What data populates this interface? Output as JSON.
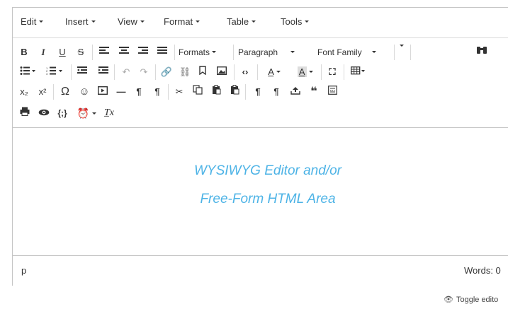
{
  "menubar": {
    "items": [
      {
        "label": "Edit"
      },
      {
        "label": "Insert"
      },
      {
        "label": "View"
      },
      {
        "label": "Format"
      },
      {
        "label": "Table"
      },
      {
        "label": "Tools"
      }
    ]
  },
  "toolbar": {
    "formats_label": "Formats",
    "paragraph_label": "Paragraph",
    "font_family_label": "Font Family",
    "bold": "B",
    "italic": "I",
    "underline": "U",
    "strikethrough": "S",
    "subscript": "x₂",
    "superscript": "x²",
    "omega": "Ω",
    "clear_format": "T̲x"
  },
  "content": {
    "placeholder_line1": "WYSIWYG Editor and/or",
    "placeholder_line2": "Free-Form HTML Area"
  },
  "statusbar": {
    "path": "p",
    "word_count": "Words: 0"
  },
  "footer": {
    "toggle_label": "Toggle edito"
  },
  "colors": {
    "placeholder": "#4db3e6",
    "border": "#c5c5c5"
  }
}
